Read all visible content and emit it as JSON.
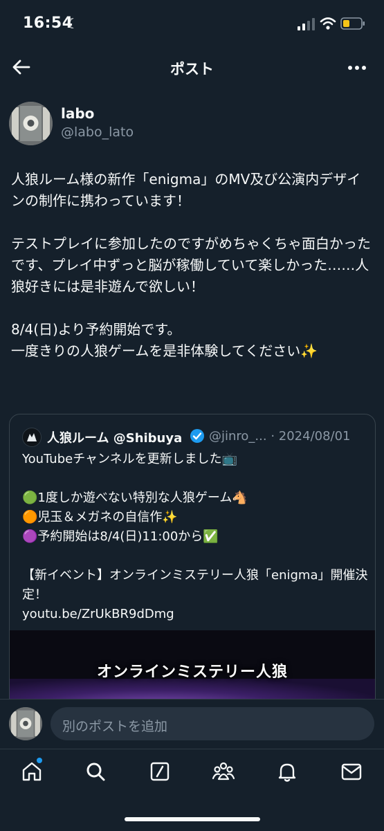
{
  "status": {
    "time": "16:54"
  },
  "header": {
    "title": "ポスト"
  },
  "post": {
    "author_name": "labo",
    "author_handle": "@labo_lato",
    "text": "人狼ルーム様の新作「enigma」のMV及び公演内デザインの制作に携わっています！\n\nテストプレイに参加したのですがめちゃくちゃ面白かったです、プレイ中ずっと脳が稼働していて楽しかった……人狼好きには是非遊んで欲しい！\n\n8/4(日)より予約開始です。\n一度きりの人狼ゲームを是非体験してください✨"
  },
  "quote": {
    "name": "人狼ルーム @Shibuya",
    "handle_date": "@jinro_... · 2024/08/01",
    "text": "YouTubeチャンネルを更新しました📺\n\n🟢1度しか遊べない特別な人狼ゲーム🐴\n🟠児玉＆メガネの自信作✨\n🟣予約開始は8/4(日)11:00から✅\n\n【新イベント】オンラインミステリー人狼「enigma」開催決定！\nyoutu.be/ZrUkBR9dDmg",
    "media_caption": "オンラインミステリー人狼"
  },
  "reply": {
    "placeholder": "別のポストを追加"
  },
  "colors": {
    "background": "#15202b",
    "accent": "#1d9bf0",
    "muted": "#8b98a5"
  }
}
